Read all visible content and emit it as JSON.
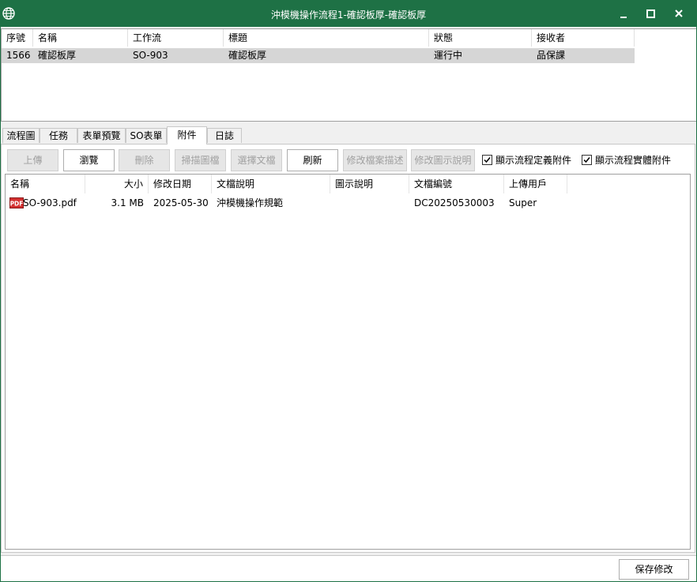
{
  "window": {
    "title": "沖模機操作流程1-確認板厚-確認板厚",
    "titlebar_color": "#1e7145",
    "icons": [
      "globe-icon",
      "minimize-icon",
      "maximize-icon",
      "close-icon"
    ]
  },
  "top_grid": {
    "columns": [
      "序號",
      "名稱",
      "工作流",
      "標題",
      "狀態",
      "接收者"
    ],
    "rows": [
      [
        "1566",
        "確認板厚",
        "SO-903",
        "確認板厚",
        "運行中",
        "品保課"
      ]
    ]
  },
  "tabs": [
    "流程圖",
    "任務",
    "表單預覽",
    "SO表單",
    "附件",
    "日誌"
  ],
  "active_tab": "附件",
  "toolbar": {
    "upload": "上傳",
    "browse": "瀏覽",
    "delete": "刪除",
    "scan": "掃描圖檔",
    "select_doc": "選擇文檔",
    "refresh": "刷新",
    "edit_file_desc": "修改檔案描述",
    "edit_icon_desc": "修改圖示說明",
    "show_def_attach": "顯示流程定義附件",
    "show_inst_attach": "顯示流程實體附件"
  },
  "file_list": {
    "columns": [
      "名稱",
      "大小",
      "修改日期",
      "文檔說明",
      "圖示說明",
      "文檔編號",
      "上傳用戶"
    ],
    "rows": [
      {
        "icon": "pdf-icon",
        "name": "SO-903.pdf",
        "size": "3.1 MB",
        "date": "2025-05-30",
        "doc_desc": "沖模機操作規範",
        "icon_desc": "",
        "doc_no": "DC20250530003",
        "uploader": "Super"
      }
    ]
  },
  "footer": {
    "save": "保存修改"
  }
}
